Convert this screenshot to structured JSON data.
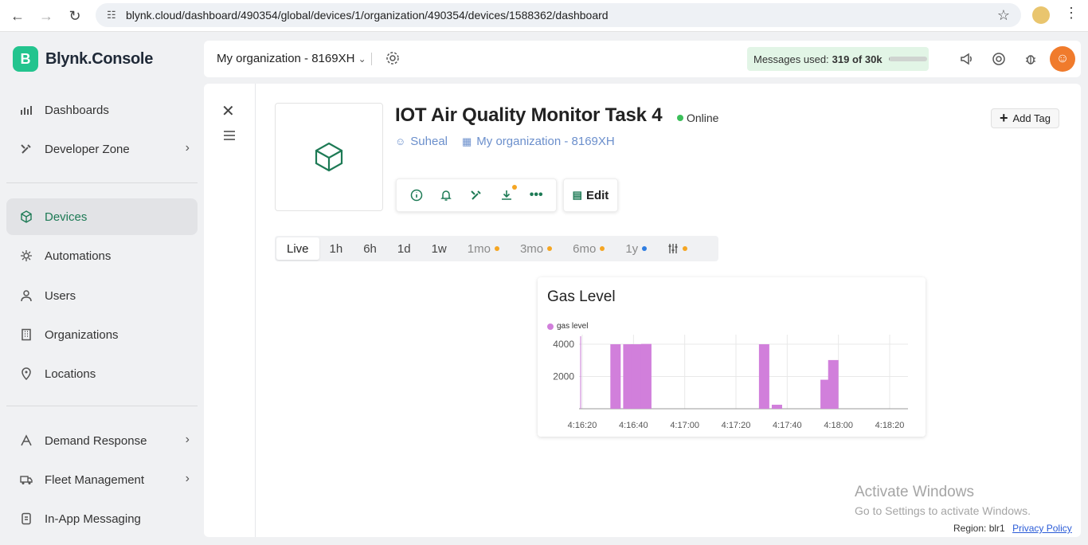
{
  "browser": {
    "url": "blynk.cloud/dashboard/490354/global/devices/1/organization/490354/devices/1588362/dashboard"
  },
  "app": {
    "logo_letter": "B",
    "name": "Blynk.Console"
  },
  "sidebar": {
    "items": [
      {
        "label": "Dashboards",
        "icon": "chart-icon"
      },
      {
        "label": "Developer Zone",
        "icon": "tools-icon",
        "expandable": true
      },
      {
        "label": "Devices",
        "icon": "cube-icon",
        "active": true
      },
      {
        "label": "Automations",
        "icon": "sun-gear-icon"
      },
      {
        "label": "Users",
        "icon": "user-icon"
      },
      {
        "label": "Organizations",
        "icon": "building-icon"
      },
      {
        "label": "Locations",
        "icon": "pin-icon"
      },
      {
        "label": "Demand Response",
        "icon": "response-icon",
        "expandable": true
      },
      {
        "label": "Fleet Management",
        "icon": "truck-icon",
        "expandable": true
      },
      {
        "label": "In-App Messaging",
        "icon": "message-icon"
      }
    ]
  },
  "header": {
    "org_label": "My organization - 8169XH",
    "messages_label": "Messages used:",
    "messages_value": "319 of 30k",
    "messages_fraction": 0.011
  },
  "device": {
    "title": "IOT Air Quality Monitor Task 4",
    "status": "Online",
    "owner": "Suheal",
    "organization": "My organization - 8169XH",
    "add_tag_label": "Add Tag",
    "edit_label": "Edit"
  },
  "time_ranges": [
    {
      "label": "Live",
      "active": true
    },
    {
      "label": "1h"
    },
    {
      "label": "6h"
    },
    {
      "label": "1d"
    },
    {
      "label": "1w"
    },
    {
      "label": "1mo",
      "dot": "#f5a623",
      "dim": true
    },
    {
      "label": "3mo",
      "dot": "#f5a623",
      "dim": true
    },
    {
      "label": "6mo",
      "dot": "#f5a623",
      "dim": true
    },
    {
      "label": "1y",
      "dot": "#2f7de1",
      "dim": true
    }
  ],
  "chart_data": {
    "type": "bar",
    "title": "Gas Level",
    "series": [
      {
        "name": "gas level",
        "color": "#d17fdb",
        "x": [
          "4:16:33",
          "4:16:38",
          "4:16:41",
          "4:16:45",
          "4:17:31",
          "4:17:36",
          "4:17:55",
          "4:17:58"
        ],
        "values": [
          4000,
          4000,
          4000,
          4020,
          4000,
          250,
          1800,
          3020
        ]
      }
    ],
    "x_ticks": [
      "4:16:20",
      "4:16:40",
      "4:17:00",
      "4:17:20",
      "4:17:40",
      "4:18:00",
      "4:18:20"
    ],
    "y_ticks": [
      2000,
      4000
    ],
    "ylim": [
      0,
      4200
    ],
    "grid": true
  },
  "watermark": {
    "line1": "Activate Windows",
    "line2": "Go to Settings to activate Windows."
  },
  "footer": {
    "region": "Region: blr1",
    "privacy": "Privacy Policy"
  }
}
